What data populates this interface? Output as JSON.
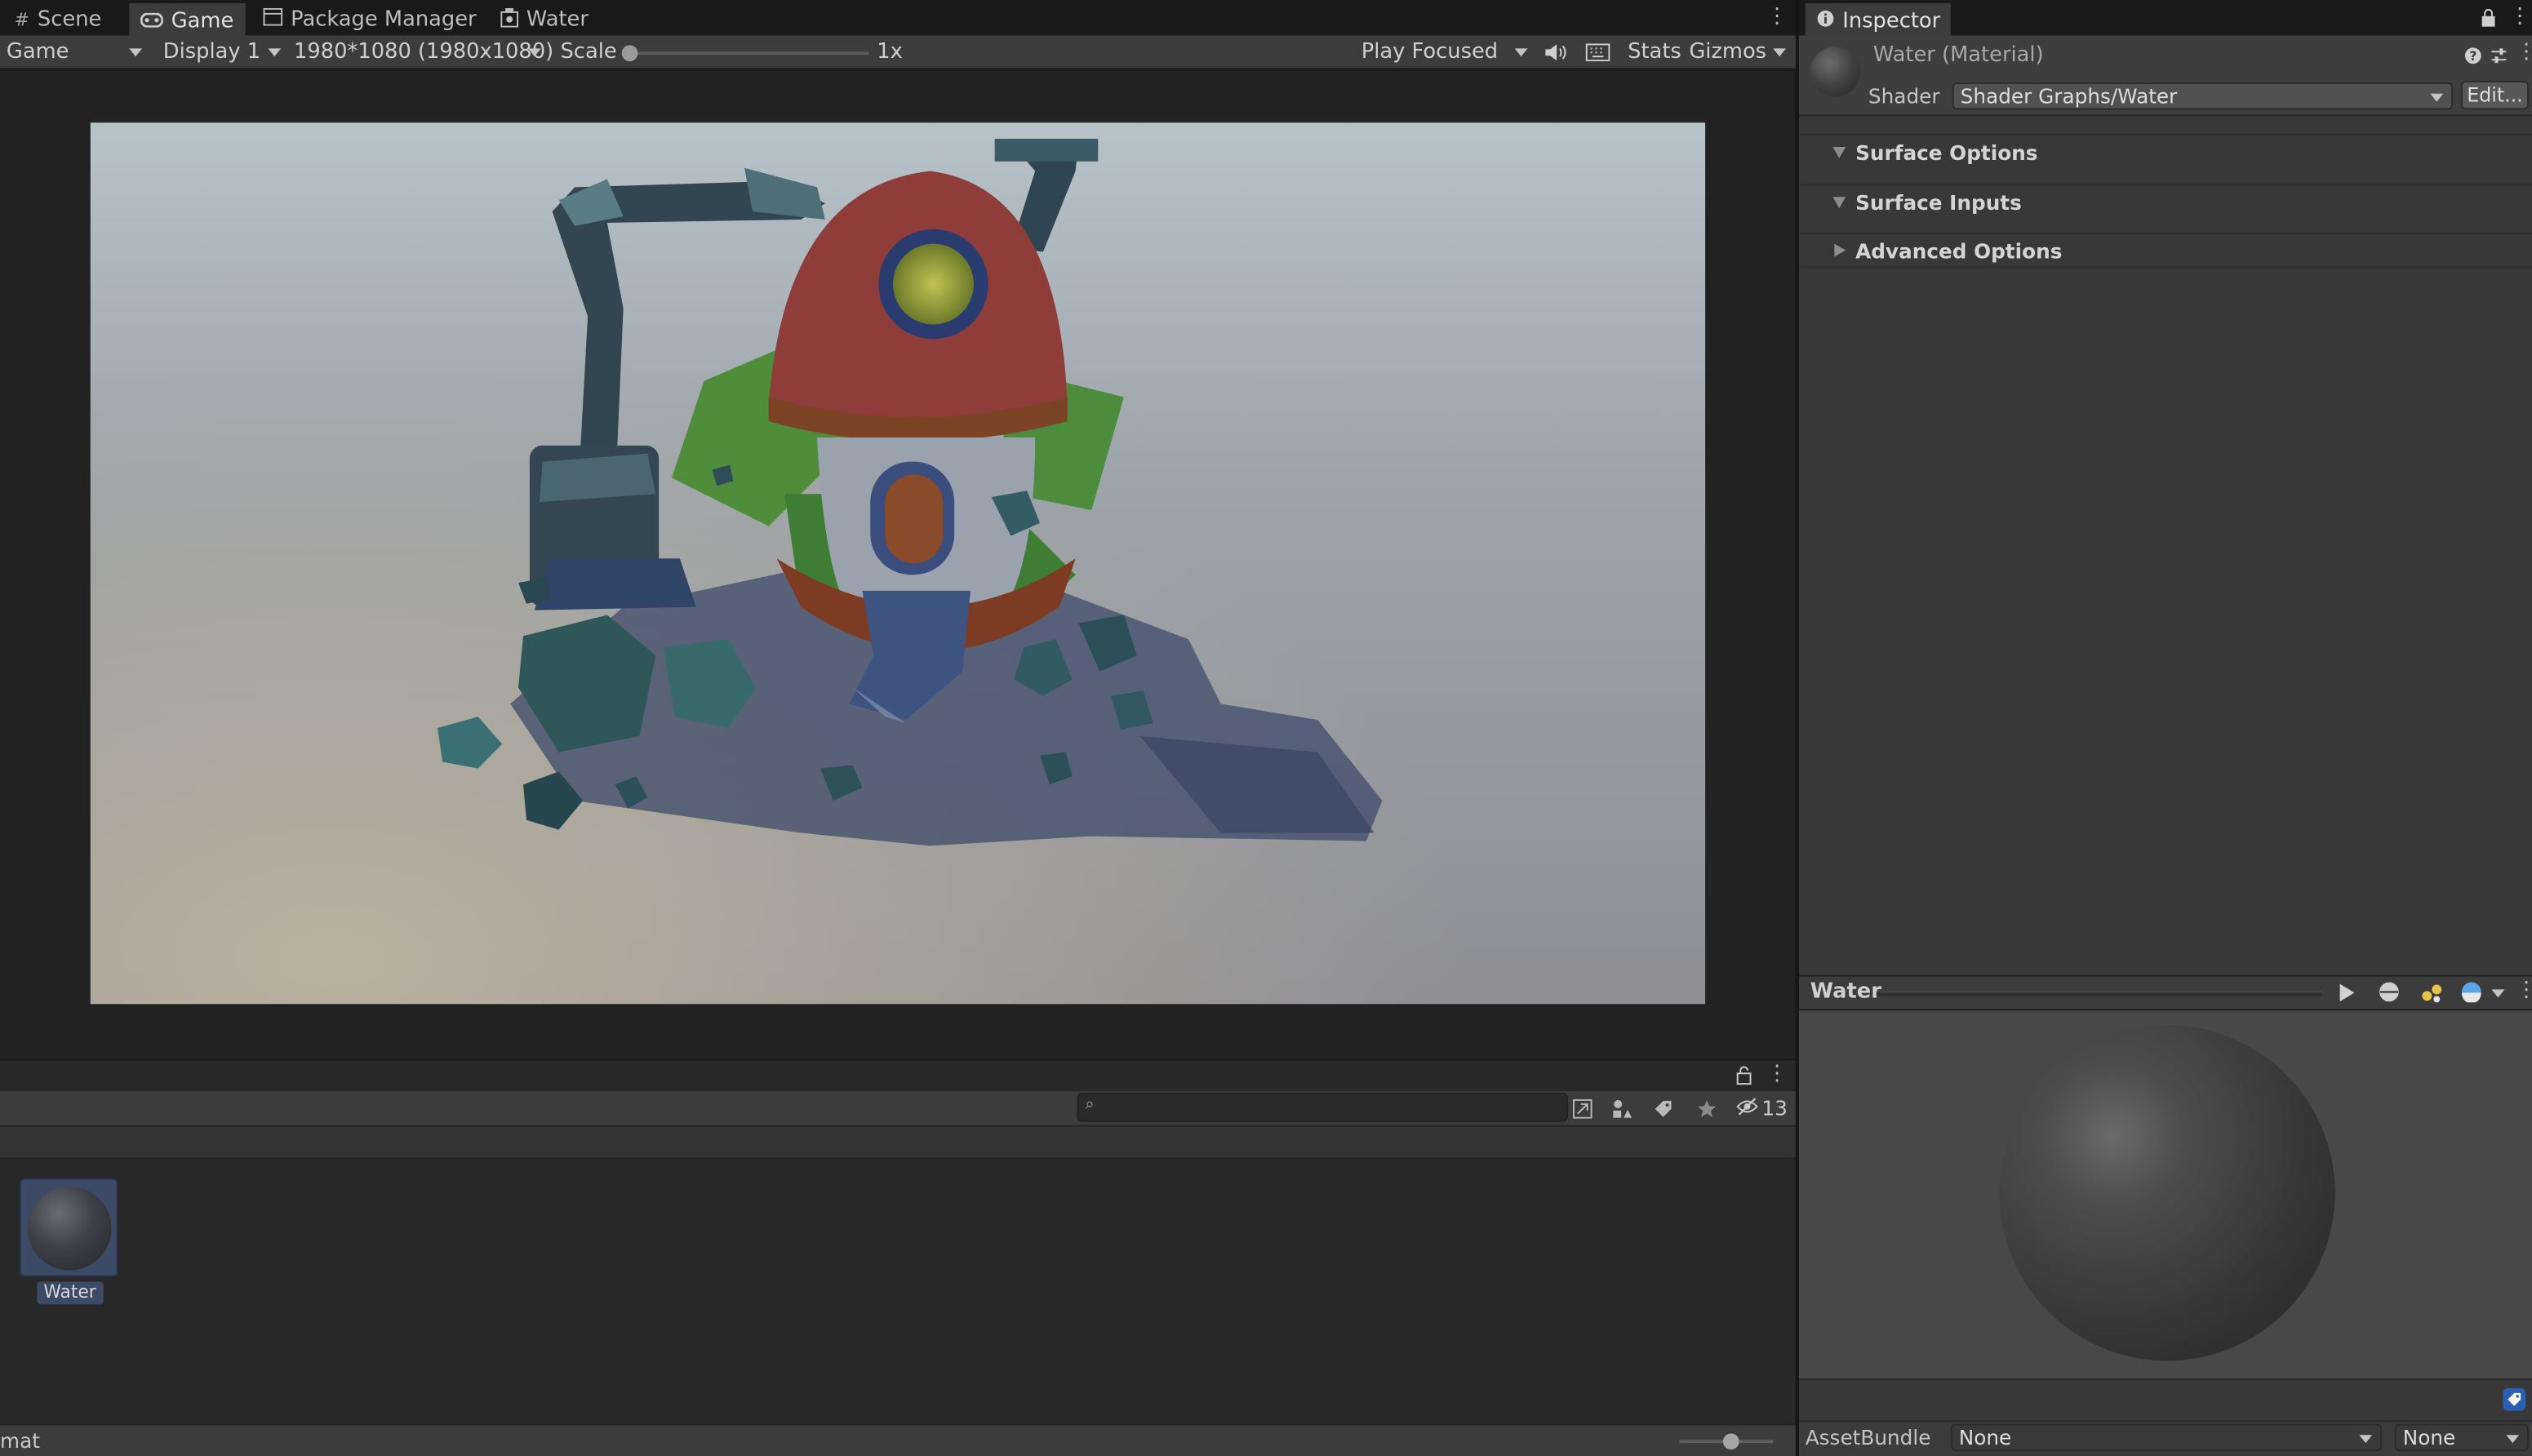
{
  "left_tabs": [
    {
      "label": "Scene",
      "icon": "grid-icon"
    },
    {
      "label": "Game",
      "icon": "gamepad-icon"
    },
    {
      "label": "Package Manager",
      "icon": "package-icon"
    },
    {
      "label": "Water",
      "icon": "shader-graph-icon"
    }
  ],
  "game_toolbar": {
    "view_select": "Game",
    "display": "Display 1",
    "resolution": "1980*1080 (1980x1080)",
    "scale_label": "Scale",
    "scale_value": "1x",
    "scale_slider_fraction": 0,
    "play_mode": "Play Focused",
    "stats": "Stats",
    "gizmos": "Gizmos"
  },
  "project_panel": {
    "hidden_count": "13",
    "asset_label": "Water",
    "status_text": "mat",
    "zoom_fraction": 0.6
  },
  "inspector": {
    "tab_label": "Inspector",
    "material_title": "Water (Material)",
    "shader_label": "Shader",
    "shader_value": "Shader Graphs/Water",
    "edit_button": "Edit...",
    "sections": [
      "Surface Options",
      "Surface Inputs",
      "Advanced Options"
    ]
  },
  "preview": {
    "title": "Water"
  },
  "assetbundle": {
    "label": "AssetBundle",
    "name_value": "None",
    "variant_value": "None"
  },
  "colors": {
    "panel_bg": "#383838",
    "toolbar_bg": "#3c3c3c",
    "tab_bar_bg": "#191919",
    "accent_blue": "#2b5fb3"
  }
}
